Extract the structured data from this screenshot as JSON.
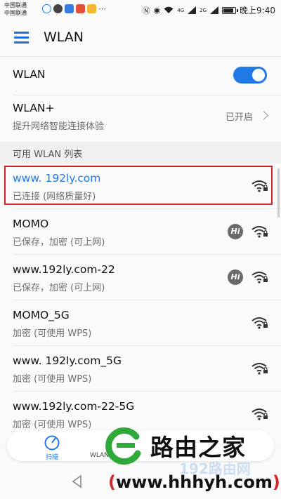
{
  "status_bar": {
    "carrier_1": "中国联通",
    "carrier_2": "中国联通",
    "network_1": "4G",
    "network_2": "2G",
    "time": "晚上9:40"
  },
  "app_bar": {
    "title": "WLAN"
  },
  "wlan_toggle": {
    "label": "WLAN",
    "enabled": true
  },
  "wlan_plus": {
    "title": "WLAN+",
    "subtitle": "提升网络智能连接体验",
    "status": "已开启"
  },
  "section_header": "可用 WLAN 列表",
  "networks": [
    {
      "ssid": "www. 192ly.com",
      "status": "已连接 (网络质量好)",
      "connected": true,
      "hi": false
    },
    {
      "ssid": "MOMO",
      "status": "已保存，加密 (可上网)",
      "connected": false,
      "hi": true
    },
    {
      "ssid": "www.192ly.com-22",
      "status": "已保存，加密 (可上网)",
      "connected": false,
      "hi": true
    },
    {
      "ssid": "MOMO_5G",
      "status": "加密 (可使用 WPS)",
      "connected": false,
      "hi": false
    },
    {
      "ssid": "www. 192ly.com_5G",
      "status": "加密 (可使用 WPS)",
      "connected": false,
      "hi": false
    },
    {
      "ssid": "www.192ly.com-22-5G",
      "status": "加密 (可使用 WPS)",
      "connected": false,
      "hi": false
    }
  ],
  "bottom_bar": {
    "scan_label": "扫描",
    "wlan_label": "WLAN"
  },
  "watermark": {
    "brand": "路由之家",
    "url_open": "(",
    "url": "www.hhhyh.com",
    "url_close": ")",
    "faint": "192路由网"
  },
  "colors": {
    "accent": "#1f7ae8",
    "highlight": "#d6222a",
    "watermark_green": "#2faa3a"
  }
}
